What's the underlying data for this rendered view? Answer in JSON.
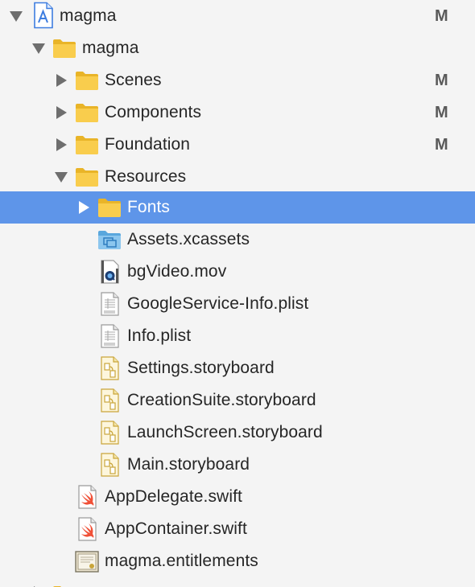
{
  "navigator": {
    "items": [
      {
        "label": "magma",
        "badge": "M",
        "icon": "xcode-project-icon",
        "expanded": true
      },
      {
        "label": "magma",
        "badge": "",
        "icon": "folder-icon",
        "expanded": true
      },
      {
        "label": "Scenes",
        "badge": "M",
        "icon": "folder-icon",
        "expanded": false
      },
      {
        "label": "Components",
        "badge": "M",
        "icon": "folder-icon",
        "expanded": false
      },
      {
        "label": "Foundation",
        "badge": "M",
        "icon": "folder-icon",
        "expanded": false
      },
      {
        "label": "Resources",
        "badge": "",
        "icon": "folder-icon",
        "expanded": true
      },
      {
        "label": "Fonts",
        "badge": "",
        "icon": "folder-icon",
        "expanded": false,
        "selected": true
      },
      {
        "label": "Assets.xcassets",
        "badge": "",
        "icon": "asset-catalog-icon"
      },
      {
        "label": "bgVideo.mov",
        "badge": "",
        "icon": "quicktime-movie-icon"
      },
      {
        "label": "GoogleService-Info.plist",
        "badge": "",
        "icon": "plist-file-icon"
      },
      {
        "label": "Info.plist",
        "badge": "",
        "icon": "plist-file-icon"
      },
      {
        "label": "Settings.storyboard",
        "badge": "",
        "icon": "storyboard-file-icon"
      },
      {
        "label": "CreationSuite.storyboard",
        "badge": "",
        "icon": "storyboard-file-icon"
      },
      {
        "label": "LaunchScreen.storyboard",
        "badge": "",
        "icon": "storyboard-file-icon"
      },
      {
        "label": "Main.storyboard",
        "badge": "",
        "icon": "storyboard-file-icon"
      },
      {
        "label": "AppDelegate.swift",
        "badge": "",
        "icon": "swift-file-icon"
      },
      {
        "label": "AppContainer.swift",
        "badge": "",
        "icon": "swift-file-icon"
      },
      {
        "label": "magma.entitlements",
        "badge": "",
        "icon": "entitlements-file-icon"
      }
    ]
  },
  "colors": {
    "background": "#f4f4f4",
    "selection": "#5e95e9",
    "folder": "#f9cd4d",
    "swift": "#f05138",
    "badge": "#5a5a5a"
  }
}
